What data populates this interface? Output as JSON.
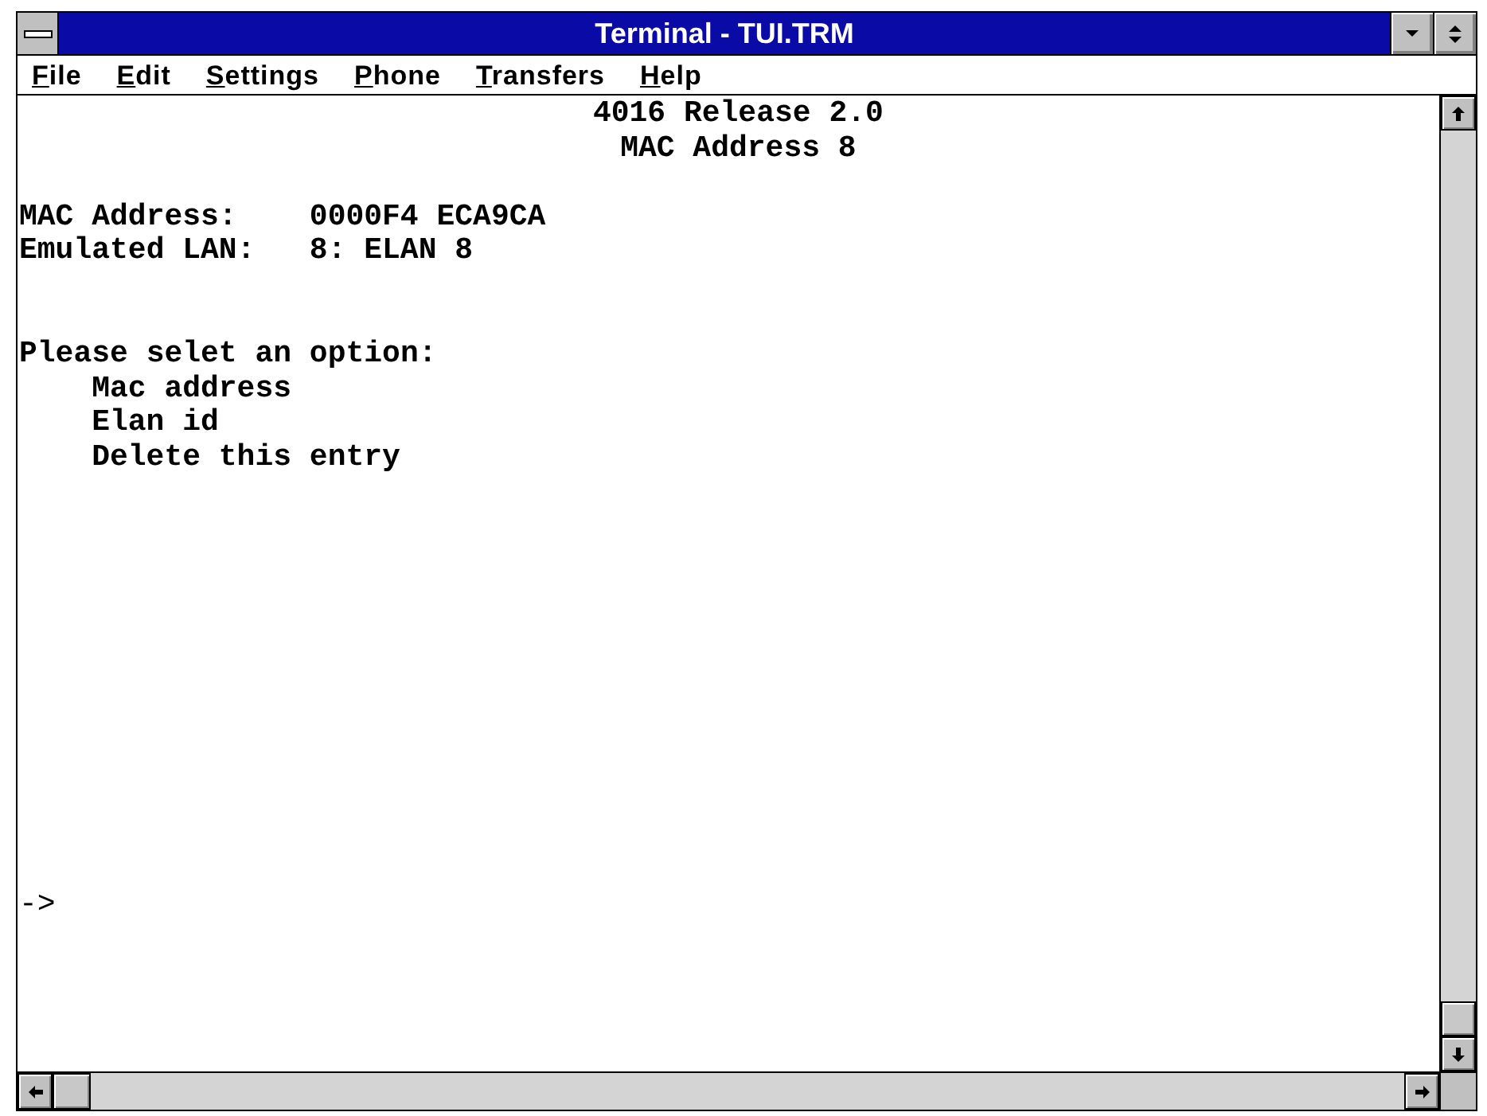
{
  "window": {
    "title": "Terminal - TUI.TRM"
  },
  "menu": [
    "File",
    "Edit",
    "Settings",
    "Phone",
    "Transfers",
    "Help"
  ],
  "terminal": {
    "header": [
      "4016 Release 2.0",
      "MAC Address 8"
    ],
    "fields": [
      {
        "label": "MAC Address:",
        "value": "0000F4 ECA9CA"
      },
      {
        "label": "Emulated LAN:",
        "value": "8: ELAN 8"
      }
    ],
    "prompt": "Please selet an option:",
    "options": [
      "Mac address",
      "Elan id",
      "Delete this entry"
    ],
    "command_prompt": "->"
  }
}
